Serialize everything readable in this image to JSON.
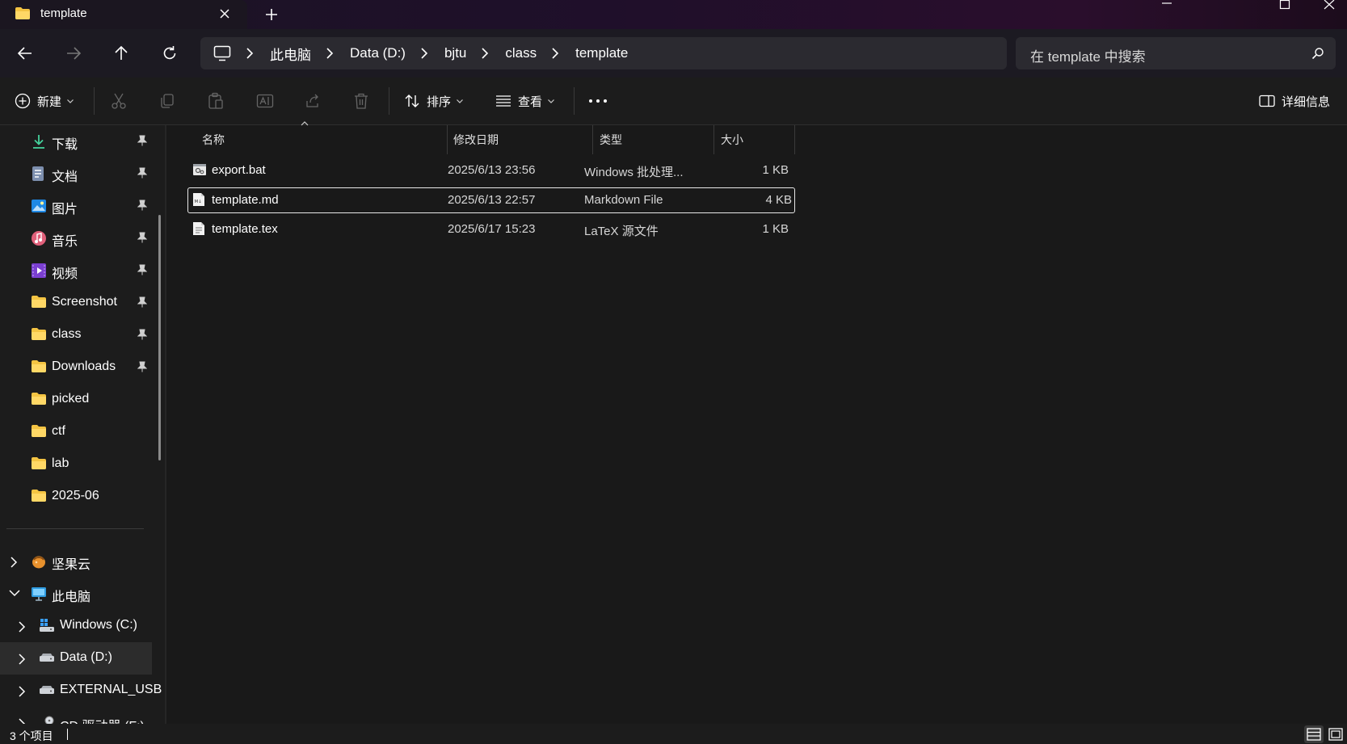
{
  "window": {
    "tab_title": "template",
    "new_tab_glyph": "+",
    "controls": [
      "minimize-icon",
      "maximize-icon",
      "close-icon"
    ]
  },
  "address_bar": {
    "crumbs": [
      "此电脑",
      "Data (D:)",
      "bjtu",
      "class",
      "template"
    ],
    "search_placeholder": "在 template 中搜索"
  },
  "toolbar": {
    "new_label": "新建",
    "sort_label": "排序",
    "view_label": "查看",
    "more_glyph": "•••",
    "details_label": "详细信息",
    "icons": [
      "cut-icon",
      "copy-icon",
      "paste-icon",
      "rename-icon",
      "share-icon",
      "delete-icon"
    ]
  },
  "sidebar": {
    "pinned": [
      {
        "label": "下载",
        "icon": "download-icon"
      },
      {
        "label": "文档",
        "icon": "document-icon"
      },
      {
        "label": "图片",
        "icon": "pictures-icon"
      },
      {
        "label": "音乐",
        "icon": "music-icon"
      },
      {
        "label": "视频",
        "icon": "video-icon"
      },
      {
        "label": "Screenshot",
        "icon": "folder-icon"
      },
      {
        "label": "class",
        "icon": "folder-icon"
      },
      {
        "label": "Downloads",
        "icon": "folder-icon"
      }
    ],
    "recent": [
      {
        "label": "picked",
        "icon": "folder-icon"
      },
      {
        "label": "ctf",
        "icon": "folder-icon"
      },
      {
        "label": "lab",
        "icon": "folder-icon"
      },
      {
        "label": "2025-06",
        "icon": "folder-icon"
      }
    ],
    "tree": [
      {
        "label": "坚果云",
        "icon": "nutstore-icon",
        "expanded": false
      },
      {
        "label": "此电脑",
        "icon": "computer-icon",
        "expanded": true
      },
      {
        "label": "Windows (C:)",
        "icon": "drive-icon",
        "expanded": false
      },
      {
        "label": "Data (D:)",
        "icon": "drive-icon",
        "expanded": false,
        "active": true
      },
      {
        "label": "EXTERNAL_USB",
        "icon": "drive-icon",
        "expanded": false
      },
      {
        "label": "CD 驱动器 (F:)",
        "icon": "cd-drive-icon",
        "expanded": false
      }
    ]
  },
  "columns": {
    "name": "名称",
    "modified": "修改日期",
    "type": "类型",
    "size": "大小",
    "sorted_by": "名称"
  },
  "files": [
    {
      "name": "export.bat",
      "modified": "2025/6/13 23:56",
      "type": "Windows 批处理...",
      "size": "1 KB",
      "icon": "batch-file-icon",
      "selected": false
    },
    {
      "name": "template.md",
      "modified": "2025/6/13 22:57",
      "type": "Markdown File",
      "size": "4 KB",
      "icon": "markdown-file-icon",
      "selected": true
    },
    {
      "name": "template.tex",
      "modified": "2025/6/17 15:23",
      "type": "LaTeX 源文件",
      "size": "1 KB",
      "icon": "text-file-icon",
      "selected": false
    }
  ],
  "status": {
    "item_count": "3 个项目"
  },
  "colors": {
    "background": "#191919",
    "folder": "#f4c443",
    "accent": "#4cc2ff"
  }
}
